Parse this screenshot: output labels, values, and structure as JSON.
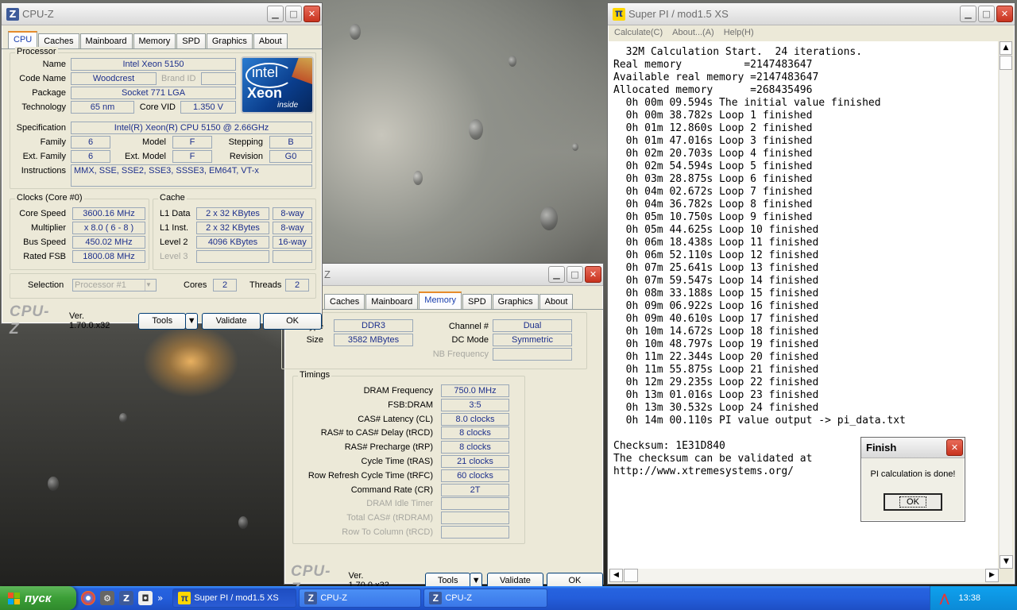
{
  "cpuz1": {
    "title": "CPU-Z",
    "tabs": [
      "CPU",
      "Caches",
      "Mainboard",
      "Memory",
      "SPD",
      "Graphics",
      "About"
    ],
    "active_tab": "CPU",
    "processor": {
      "caption": "Processor",
      "name_label": "Name",
      "name": "Intel Xeon 5150",
      "codename_label": "Code Name",
      "codename": "Woodcrest",
      "brandid_label": "Brand ID",
      "package_label": "Package",
      "package": "Socket 771 LGA",
      "technology_label": "Technology",
      "technology": "65 nm",
      "corevid_label": "Core VID",
      "corevid": "1.350 V",
      "spec_label": "Specification",
      "spec": "Intel(R) Xeon(R) CPU        5150  @ 2.66GHz",
      "family_label": "Family",
      "family": "6",
      "model_label": "Model",
      "model": "F",
      "stepping_label": "Stepping",
      "stepping": "B",
      "extfamily_label": "Ext. Family",
      "extfamily": "6",
      "extmodel_label": "Ext. Model",
      "extmodel": "F",
      "revision_label": "Revision",
      "revision": "G0",
      "instructions_label": "Instructions",
      "instructions": "MMX, SSE, SSE2, SSE3, SSSE3, EM64T, VT-x"
    },
    "logo": {
      "brand": "intel",
      "product": "Xeon",
      "tag": "inside"
    },
    "clocks": {
      "caption": "Clocks (Core #0)",
      "corespeed_label": "Core Speed",
      "corespeed": "3600.16 MHz",
      "multiplier_label": "Multiplier",
      "multiplier": "x 8.0 ( 6 - 8 )",
      "busspeed_label": "Bus Speed",
      "busspeed": "450.02 MHz",
      "ratedfsb_label": "Rated FSB",
      "ratedfsb": "1800.08 MHz"
    },
    "cache": {
      "caption": "Cache",
      "l1d_label": "L1 Data",
      "l1d": "2 x 32 KBytes",
      "l1d_way": "8-way",
      "l1i_label": "L1 Inst.",
      "l1i": "2 x 32 KBytes",
      "l1i_way": "8-way",
      "l2_label": "Level 2",
      "l2": "4096 KBytes",
      "l2_way": "16-way",
      "l3_label": "Level 3"
    },
    "selection_label": "Selection",
    "selection": "Processor #1",
    "cores_label": "Cores",
    "cores": "2",
    "threads_label": "Threads",
    "threads": "2",
    "footer": {
      "brand": "CPU-Z",
      "version": "Ver. 1.70.0.x32",
      "tools": "Tools",
      "validate": "Validate",
      "ok": "OK"
    }
  },
  "cpuz2": {
    "title": "Z",
    "tabs": [
      "Caches",
      "Mainboard",
      "Memory",
      "SPD",
      "Graphics",
      "About"
    ],
    "active_tab": "Memory",
    "general": {
      "caption": "al",
      "type_label": "Type",
      "type": "DDR3",
      "size_label": "Size",
      "size": "3582 MBytes",
      "channel_label": "Channel #",
      "channel": "Dual",
      "dcmode_label": "DC Mode",
      "dcmode": "Symmetric",
      "nbfreq_label": "NB Frequency"
    },
    "timings": {
      "caption": "Timings",
      "rows": [
        {
          "label": "DRAM Frequency",
          "value": "750.0 MHz",
          "dim": false
        },
        {
          "label": "FSB:DRAM",
          "value": "3:5",
          "dim": false
        },
        {
          "label": "CAS# Latency (CL)",
          "value": "8.0 clocks",
          "dim": false
        },
        {
          "label": "RAS# to CAS# Delay (tRCD)",
          "value": "8 clocks",
          "dim": false
        },
        {
          "label": "RAS# Precharge (tRP)",
          "value": "8 clocks",
          "dim": false
        },
        {
          "label": "Cycle Time (tRAS)",
          "value": "21 clocks",
          "dim": false
        },
        {
          "label": "Row Refresh Cycle Time (tRFC)",
          "value": "60 clocks",
          "dim": false
        },
        {
          "label": "Command Rate (CR)",
          "value": "2T",
          "dim": false
        },
        {
          "label": "DRAM Idle Timer",
          "value": "",
          "dim": true
        },
        {
          "label": "Total CAS# (tRDRAM)",
          "value": "",
          "dim": true
        },
        {
          "label": "Row To Column (tRCD)",
          "value": "",
          "dim": true
        }
      ]
    },
    "footer": {
      "brand": "CPU-Z",
      "version": "Ver. 1.70.0.x32",
      "tools": "Tools",
      "validate": "Validate",
      "ok": "OK"
    }
  },
  "superpi": {
    "title": "Super PI / mod1.5 XS",
    "menu": [
      "Calculate(C)",
      "About...(A)",
      "Help(H)"
    ],
    "console_lines": [
      "  32M Calculation Start.  24 iterations.",
      "Real memory          =2147483647",
      "Available real memory =2147483647",
      "Allocated memory      =268435496",
      "  0h 00m 09.594s The initial value finished",
      "  0h 00m 38.782s Loop 1 finished",
      "  0h 01m 12.860s Loop 2 finished",
      "  0h 01m 47.016s Loop 3 finished",
      "  0h 02m 20.703s Loop 4 finished",
      "  0h 02m 54.594s Loop 5 finished",
      "  0h 03m 28.875s Loop 6 finished",
      "  0h 04m 02.672s Loop 7 finished",
      "  0h 04m 36.782s Loop 8 finished",
      "  0h 05m 10.750s Loop 9 finished",
      "  0h 05m 44.625s Loop 10 finished",
      "  0h 06m 18.438s Loop 11 finished",
      "  0h 06m 52.110s Loop 12 finished",
      "  0h 07m 25.641s Loop 13 finished",
      "  0h 07m 59.547s Loop 14 finished",
      "  0h 08m 33.188s Loop 15 finished",
      "  0h 09m 06.922s Loop 16 finished",
      "  0h 09m 40.610s Loop 17 finished",
      "  0h 10m 14.672s Loop 18 finished",
      "  0h 10m 48.797s Loop 19 finished",
      "  0h 11m 22.344s Loop 20 finished",
      "  0h 11m 55.875s Loop 21 finished",
      "  0h 12m 29.235s Loop 22 finished",
      "  0h 13m 01.016s Loop 23 finished",
      "  0h 13m 30.532s Loop 24 finished",
      "  0h 14m 00.110s PI value output -> pi_data.txt",
      "",
      "Checksum: 1E31D840",
      "The checksum can be validated at",
      "http://www.xtremesystems.org/"
    ]
  },
  "dialog": {
    "title": "Finish",
    "message": "PI calculation is done!",
    "ok": "OK"
  },
  "taskbar": {
    "start": "пуск",
    "items": [
      "Super PI / mod1.5 XS",
      "CPU-Z",
      "CPU-Z"
    ],
    "lang": "EN",
    "clock": "13:38",
    "more": "»"
  }
}
